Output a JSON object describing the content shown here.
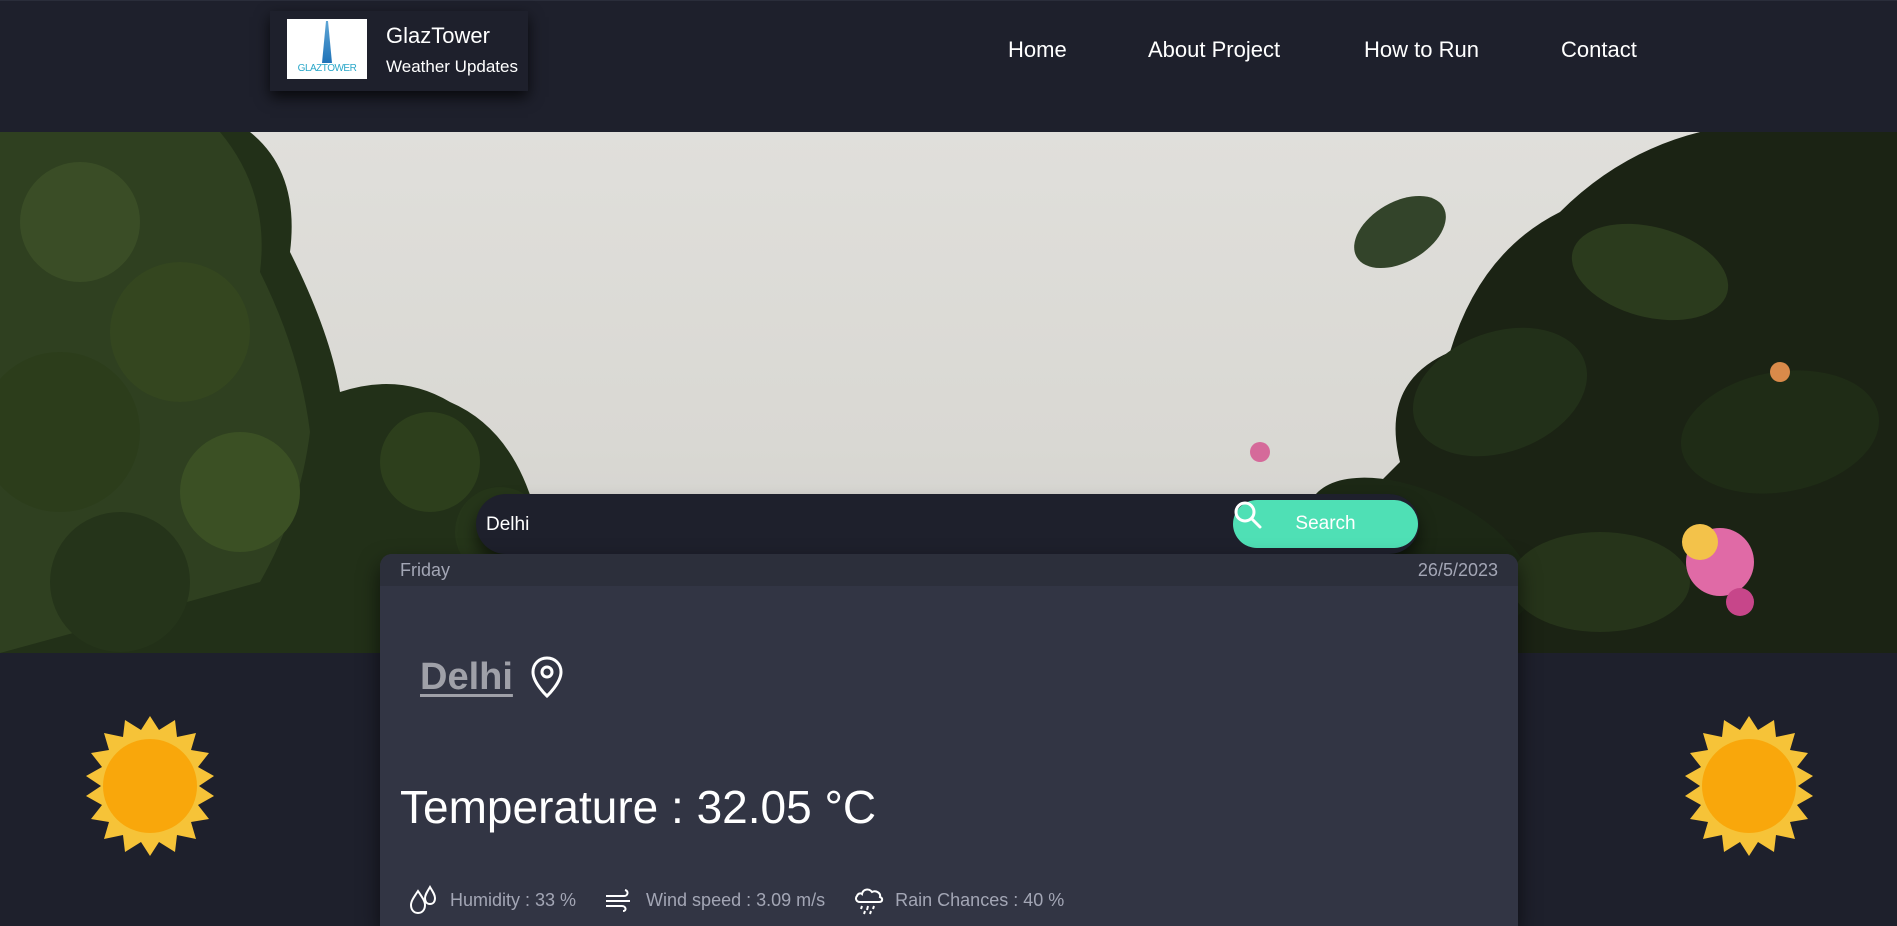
{
  "brand": {
    "logo_text": "GLAZTOWER",
    "name": "GlazTower",
    "subtitle": "Weather Updates"
  },
  "nav": {
    "items": [
      "Home",
      "About Project",
      "How to Run",
      "Contact"
    ]
  },
  "search": {
    "value": "Delhi",
    "button_label": "Search"
  },
  "weather": {
    "day": "Friday",
    "date": "26/5/2023",
    "city": "Delhi",
    "temperature": "Temperature : 32.05 °C",
    "humidity": "Humidity : 33 %",
    "wind": "Wind speed : 3.09 m/s",
    "rain": "Rain Chances : 40 %"
  },
  "colors": {
    "background": "#1e202c",
    "card": "#323544",
    "accent": "#4fe0b5",
    "sun": "#f9a70b"
  }
}
